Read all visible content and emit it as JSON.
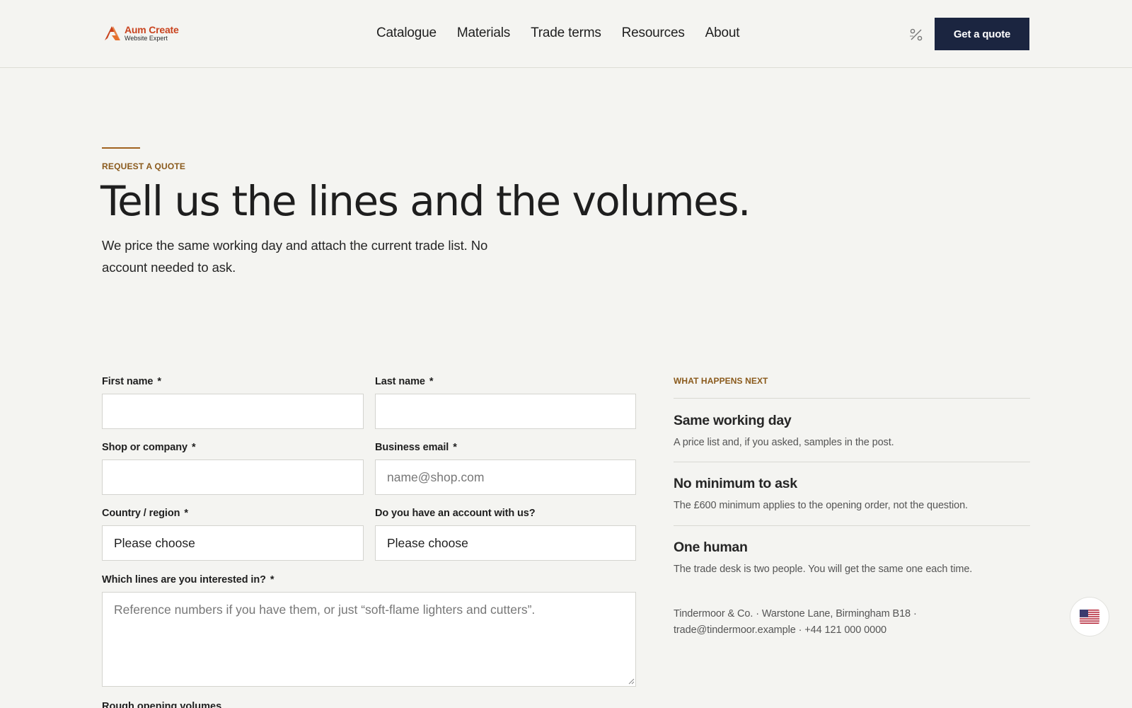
{
  "brand": {
    "title": "Aum Create",
    "subtitle": "Website Expert",
    "accent_color": "#c9431e"
  },
  "nav": {
    "items": [
      {
        "label": "Catalogue"
      },
      {
        "label": "Materials"
      },
      {
        "label": "Trade terms"
      },
      {
        "label": "Resources"
      },
      {
        "label": "About"
      }
    ],
    "cta_label": "Get a quote",
    "cta_color": "#1b2540",
    "extra_icon": "percent-icon"
  },
  "hero": {
    "eyebrow": "REQUEST A QUOTE",
    "title": "Tell us the lines and the volumes.",
    "subtitle": "We price the same working day and attach the current trade list. No account needed to ask."
  },
  "form": {
    "required_mark": "*",
    "first_name": {
      "label": "First name",
      "value": "",
      "placeholder": ""
    },
    "last_name": {
      "label": "Last name",
      "value": "",
      "placeholder": ""
    },
    "company": {
      "label": "Shop or company",
      "value": "",
      "placeholder": ""
    },
    "email": {
      "label": "Business email",
      "value": "",
      "placeholder": "name@shop.com"
    },
    "country": {
      "label": "Country / region",
      "selected": "Please choose"
    },
    "account": {
      "label": "Do you have an account with us?",
      "selected": "Please choose"
    },
    "lines": {
      "label": "Which lines are you interested in?",
      "value": "",
      "placeholder": "Reference numbers if you have them, or just “soft-flame lighters and cutters”."
    },
    "next_label": "Rough opening volumes"
  },
  "aside": {
    "eyebrow": "WHAT HAPPENS NEXT",
    "steps": [
      {
        "title": "Same working day",
        "text": "A price list and, if you asked, samples in the post."
      },
      {
        "title": "No minimum to ask",
        "text": "The £600 minimum applies to the opening order, not the question."
      },
      {
        "title": "One human",
        "text": "The trade desk is two people. You will get the same one each time."
      }
    ],
    "contact": "Tindermoor & Co. · Warstone Lane, Birmingham B18 · trade@tindermoor.example · +44 121 000 0000"
  },
  "floating": {
    "icon": "us-flag-icon"
  }
}
